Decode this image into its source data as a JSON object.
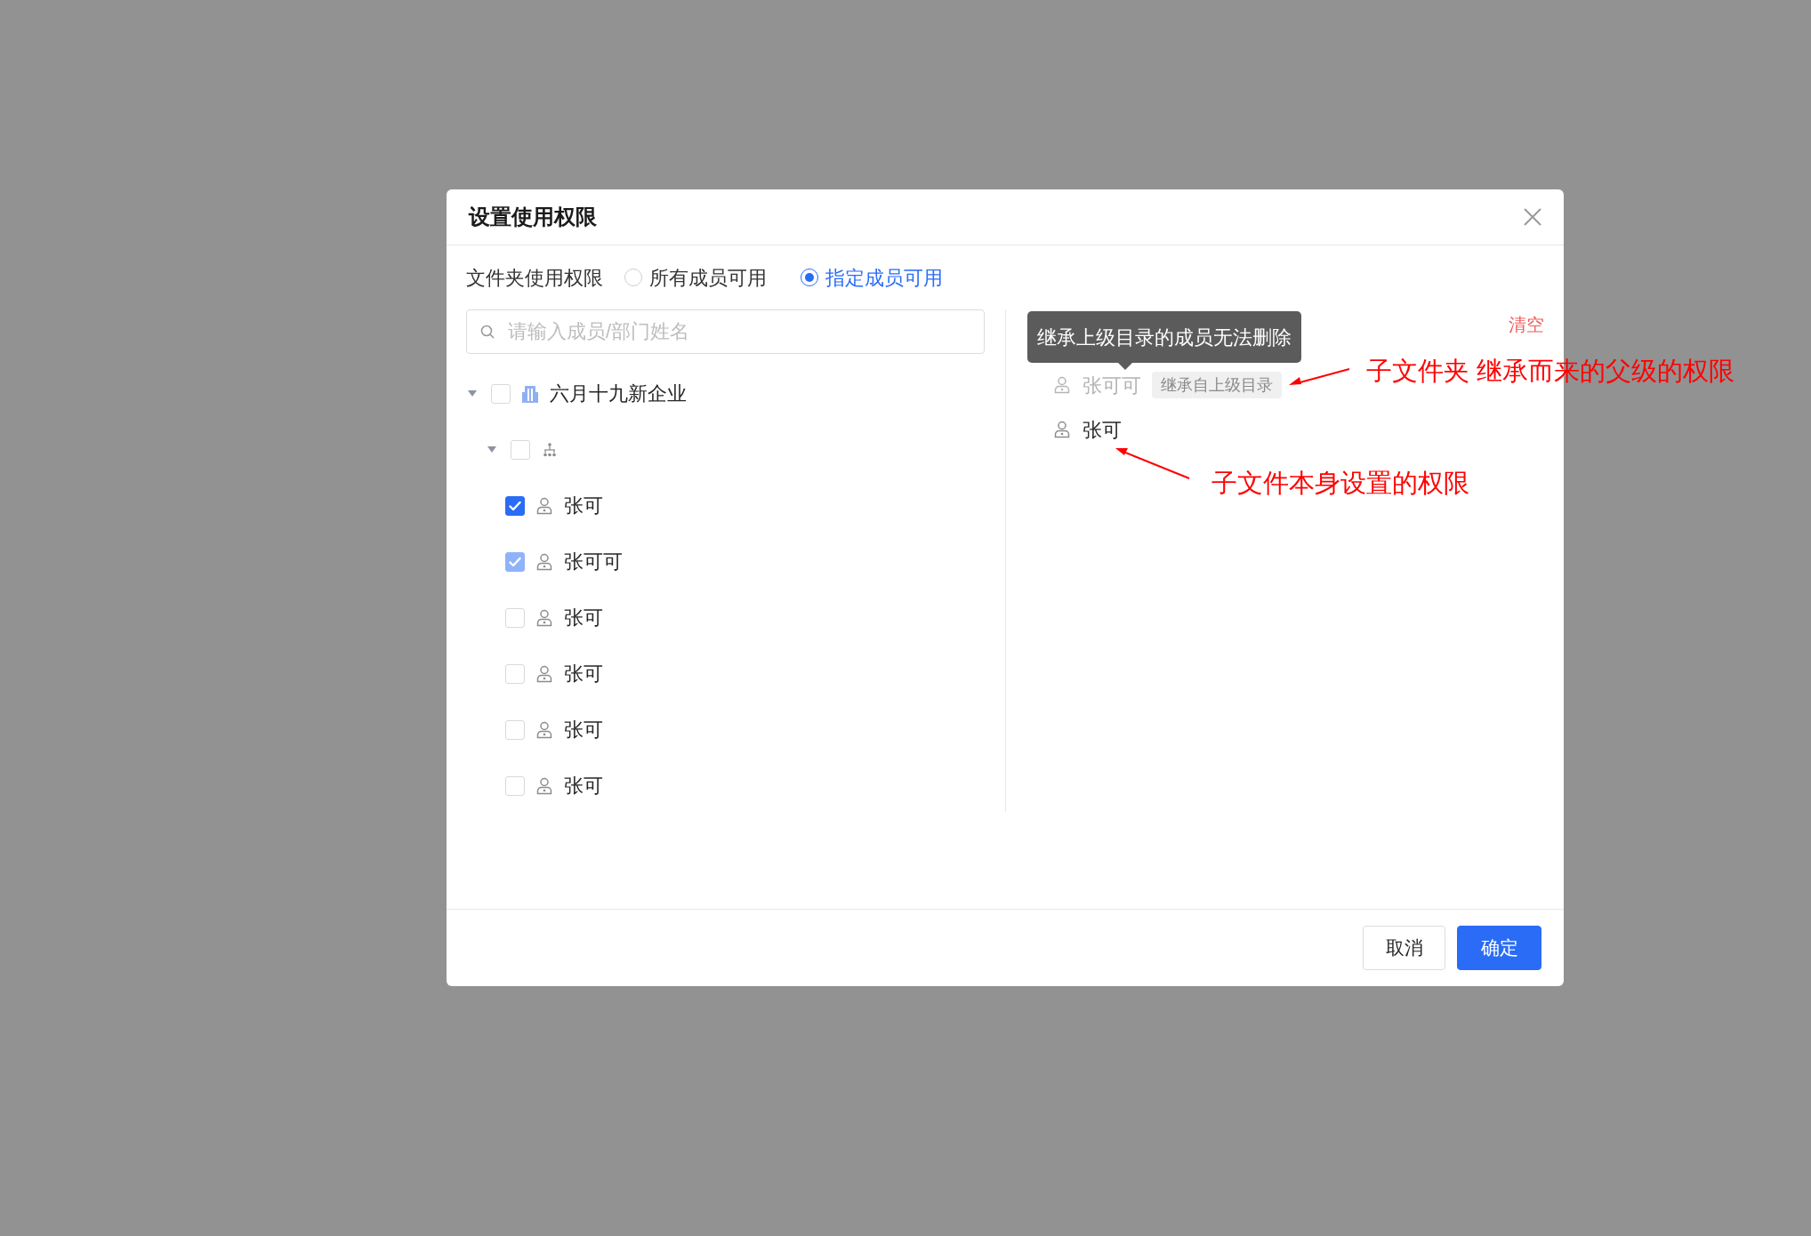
{
  "dialog": {
    "title": "设置使用权限"
  },
  "permission": {
    "label": "文件夹使用权限",
    "options": [
      {
        "label": "所有成员可用",
        "selected": false
      },
      {
        "label": "指定成员可用",
        "selected": true
      }
    ]
  },
  "search": {
    "placeholder": "请输入成员/部门姓名"
  },
  "tree": [
    {
      "kind": "company",
      "label": "六月十九新企业",
      "checked": false,
      "expanded": true,
      "children": [
        {
          "kind": "department",
          "checked": false,
          "expanded": true,
          "children": [
            {
              "kind": "member",
              "label": "张可",
              "checked": true,
              "disabled": false
            },
            {
              "kind": "member",
              "label": "张可可",
              "checked": true,
              "disabled": true
            },
            {
              "kind": "member",
              "label": "张可",
              "checked": false,
              "disabled": false
            },
            {
              "kind": "member",
              "label": "张可",
              "checked": false,
              "disabled": false
            },
            {
              "kind": "member",
              "label": "张可",
              "checked": false,
              "disabled": false
            },
            {
              "kind": "member",
              "label": "张可",
              "checked": false,
              "disabled": false
            }
          ]
        }
      ]
    }
  ],
  "selected_panel": {
    "clear": "清空",
    "tooltip": "继承上级目录的成员无法删除",
    "members": [
      {
        "name": "张可可",
        "inherited": true,
        "tag": "继承自上级目录"
      },
      {
        "name": "张可",
        "inherited": false
      }
    ]
  },
  "footer": {
    "buttons": [
      {
        "label": "取消",
        "kind": "secondary"
      },
      {
        "label": "确定",
        "kind": "primary"
      }
    ]
  },
  "annotations": [
    {
      "text": "子文件夹 继承而来的父级的权限"
    },
    {
      "text": "子文件本身设置的权限"
    }
  ]
}
